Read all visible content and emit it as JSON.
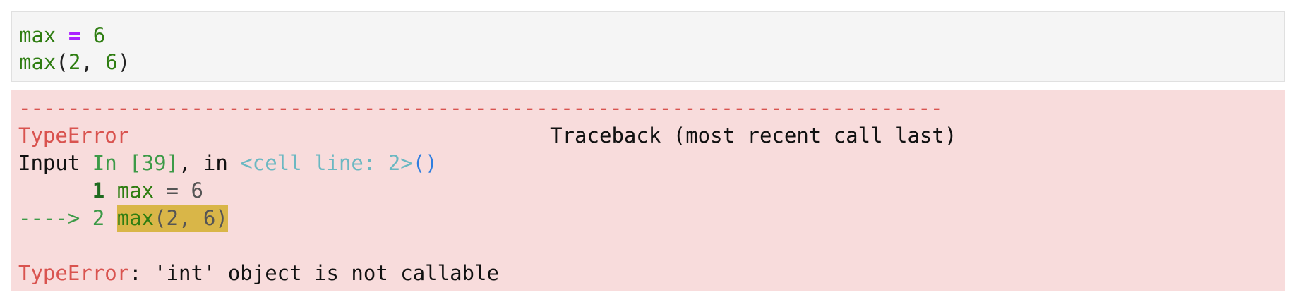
{
  "input": {
    "lines": [
      {
        "var": "max",
        "op": "=",
        "num": "6"
      },
      {
        "call": "max",
        "open": "(",
        "a": "2",
        "sep": ", ",
        "b": "6",
        "close": ")"
      }
    ]
  },
  "output": {
    "separator": "---------------------------------------------------------------------------",
    "error_type": "TypeError",
    "traceback_title": "Traceback (most recent call last)",
    "input_prefix": "Input ",
    "in_label": "In [39]",
    "in_sep": ", in ",
    "cell_line": "<cell line: 2>",
    "parens": "()",
    "line1": {
      "num": "1",
      "var": "max",
      "rest": " = 6"
    },
    "line2": {
      "arrow": "----> 2 ",
      "call": "max",
      "args": "(2, 6)"
    },
    "error_message": ": 'int' object is not callable"
  },
  "colors": {
    "error_red": "#d9534f",
    "output_bg": "#f8dcdc",
    "input_bg": "#f5f5f5",
    "highlight": "#d9b648"
  }
}
